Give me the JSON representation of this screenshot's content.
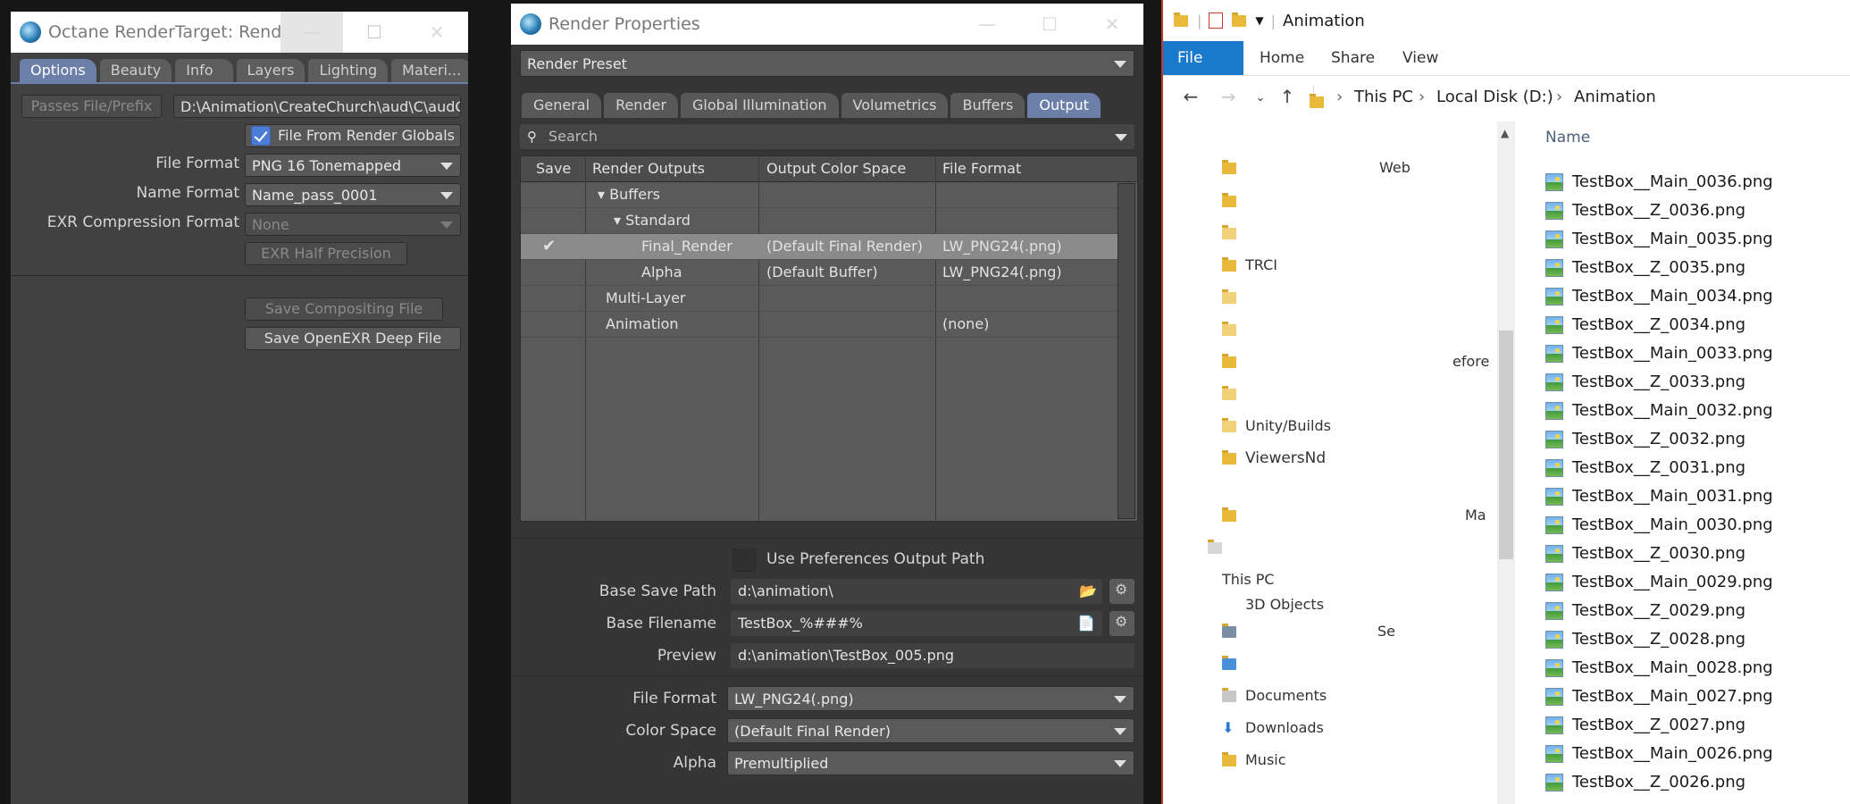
{
  "octane": {
    "title": "Octane RenderTarget: Render P...",
    "controls": {
      "minimize": "—",
      "maximize": "☐",
      "close": "✕"
    },
    "tabs": [
      "Options",
      "Beauty",
      "Info",
      "Layers",
      "Lighting",
      "Materi..."
    ],
    "passes_prefix_label": "Passes File/Prefix",
    "passes_prefix_value": "D:\\Animation\\CreateChurch\\aud\\C\\audC",
    "file_from_globals_label": "File From Render Globals",
    "file_format_label": "File Format",
    "file_format_value": "PNG 16 Tonemapped",
    "name_format_label": "Name Format",
    "name_format_value": "Name_pass_0001",
    "exr_compression_label": "EXR Compression Format",
    "exr_compression_value": "None",
    "exr_half_label": "EXR Half Precision",
    "save_compositing_label": "Save Compositing File",
    "save_openexr_label": "Save OpenEXR Deep File"
  },
  "render": {
    "title": "Render Properties",
    "controls": {
      "minimize": "—",
      "maximize": "☐",
      "close": "✕"
    },
    "preset_value": "Render Preset",
    "tabs": [
      "General",
      "Render",
      "Global Illumination",
      "Volumetrics",
      "Buffers",
      "Output"
    ],
    "search_placeholder": "Search",
    "grid_headers": {
      "save": "Save",
      "outputs": "Render Outputs",
      "color_space": "Output Color Space",
      "file_format": "File Format"
    },
    "rows": [
      {
        "save": "",
        "output": "▾ Buffers",
        "color_space": "",
        "format": ""
      },
      {
        "save": "",
        "output": "▾ Standard",
        "color_space": "",
        "format": ""
      },
      {
        "save": "✔",
        "output": "Final_Render",
        "color_space": "(Default Final Render)",
        "format": "LW_PNG24(.png)"
      },
      {
        "save": "",
        "output": "Alpha",
        "color_space": "(Default Buffer)",
        "format": "LW_PNG24(.png)"
      },
      {
        "save": "",
        "output": "Multi-Layer",
        "color_space": "",
        "format": ""
      },
      {
        "save": "",
        "output": "Animation",
        "color_space": "",
        "format": "(none)"
      }
    ],
    "use_pref_label": "Use Preferences Output Path",
    "base_save_path_label": "Base Save Path",
    "base_save_path_value": "d:\\animation\\",
    "base_filename_label": "Base Filename",
    "base_filename_value": "TestBox_%###%",
    "preview_label": "Preview",
    "preview_value": "d:\\animation\\TestBox_005.png",
    "file_format_label": "File Format",
    "file_format_value": "LW_PNG24(.png)",
    "color_space_label": "Color Space",
    "color_space_value": "(Default Final Render)",
    "alpha_label": "Alpha",
    "alpha_value": "Premultiplied"
  },
  "explorer": {
    "title": "Animation",
    "ribbon": {
      "file": "File",
      "home": "Home",
      "share": "Share",
      "view": "View"
    },
    "breadcrumb": [
      "This PC",
      "Local Disk (D:)",
      "Animation"
    ],
    "column_name": "Name",
    "nav_items": [
      "Web",
      "",
      "",
      "TRCI",
      "",
      "",
      "efore",
      "",
      "Unity/Builds",
      "ViewersNd",
      "Ma",
      "",
      "This PC",
      "3D Objects",
      "Se",
      "",
      "Documents",
      "Downloads",
      "Music"
    ],
    "files": [
      "TestBox__Main_0036.png",
      "TestBox__Z_0036.png",
      "TestBox__Main_0035.png",
      "TestBox__Z_0035.png",
      "TestBox__Main_0034.png",
      "TestBox__Z_0034.png",
      "TestBox__Main_0033.png",
      "TestBox__Z_0033.png",
      "TestBox__Main_0032.png",
      "TestBox__Z_0032.png",
      "TestBox__Z_0031.png",
      "TestBox__Main_0031.png",
      "TestBox__Main_0030.png",
      "TestBox__Z_0030.png",
      "TestBox__Main_0029.png",
      "TestBox__Z_0029.png",
      "TestBox__Z_0028.png",
      "TestBox__Main_0028.png",
      "TestBox__Main_0027.png",
      "TestBox__Z_0027.png",
      "TestBox__Main_0026.png",
      "TestBox__Z_0026.png"
    ]
  },
  "colors": {
    "accent_tab": "#6b7fa8",
    "checkbox_on": "#4c7dd6",
    "explorer_file_tab": "#1979ca"
  }
}
